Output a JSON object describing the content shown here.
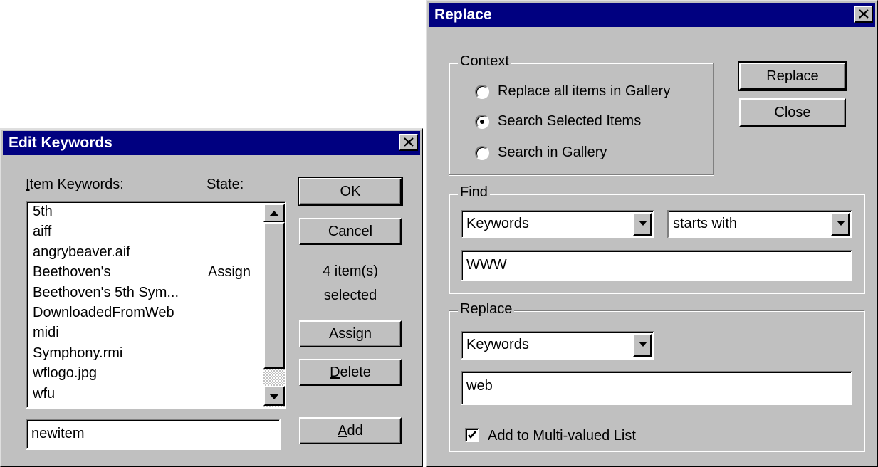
{
  "edit_keywords": {
    "title": "Edit Keywords",
    "item_keywords_label_prefix": "",
    "item_keywords_label_hotkey": "I",
    "item_keywords_label_rest": "tem Keywords:",
    "state_label": "State:",
    "items": [
      {
        "keyword": "5th",
        "state": ""
      },
      {
        "keyword": "aiff",
        "state": ""
      },
      {
        "keyword": "angrybeaver.aif",
        "state": ""
      },
      {
        "keyword": "Beethoven's",
        "state": "Assign"
      },
      {
        "keyword": "Beethoven's 5th Sym...",
        "state": ""
      },
      {
        "keyword": "DownloadedFromWeb",
        "state": ""
      },
      {
        "keyword": "midi",
        "state": ""
      },
      {
        "keyword": "Symphony.rmi",
        "state": ""
      },
      {
        "keyword": "wflogo.jpg",
        "state": ""
      },
      {
        "keyword": "wfu",
        "state": ""
      }
    ],
    "ok_label": "OK",
    "cancel_label": "Cancel",
    "selection_count": "4 item(s)",
    "selection_suffix": "selected",
    "assign_label_prefix": "Assi",
    "assign_label_hotkey": "g",
    "assign_label_rest": "n",
    "delete_label_hotkey": "D",
    "delete_label_rest": "elete",
    "add_label_hotkey": "A",
    "add_label_rest": "dd",
    "new_item_value": "newitem"
  },
  "replace": {
    "title": "Replace",
    "context_legend": "Context",
    "context_options": [
      {
        "label": "Replace all items in Gallery",
        "selected": false
      },
      {
        "label": "Search Selected Items",
        "selected": true
      },
      {
        "label": "Search in Gallery",
        "selected": false
      }
    ],
    "replace_button": "Replace",
    "close_button": "Close",
    "find_legend": "Find",
    "find_field": "Keywords",
    "find_operator": "starts with",
    "find_value": "WWW",
    "replace_legend": "Replace",
    "replace_field": "Keywords",
    "replace_value": "web",
    "multi_valued_label": "Add to Multi-valued List",
    "multi_valued_checked": true
  }
}
